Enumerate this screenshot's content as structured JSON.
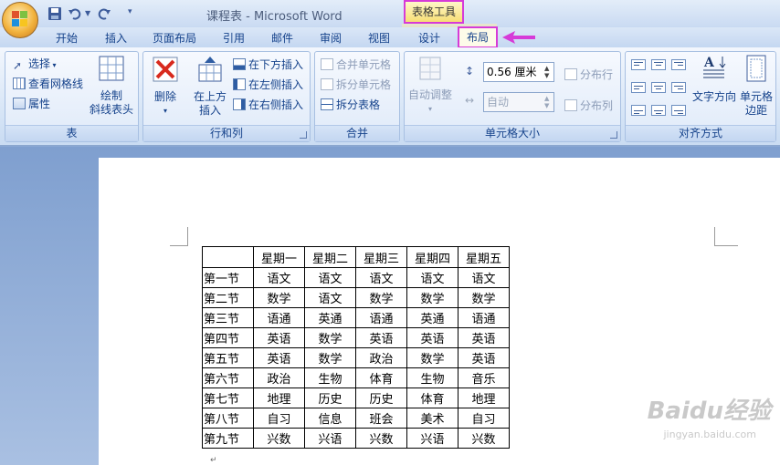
{
  "window": {
    "title": "课程表 - Microsoft Word",
    "context_tools_label": "表格工具"
  },
  "tabs": [
    "开始",
    "插入",
    "页面布局",
    "引用",
    "邮件",
    "审阅",
    "视图",
    "设计",
    "布局"
  ],
  "active_tab": "布局",
  "ribbon": {
    "table_group": {
      "label": "表",
      "select": "选择",
      "gridlines": "查看网格线",
      "properties": "属性",
      "draw_diag_1": "绘制",
      "draw_diag_2": "斜线表头"
    },
    "rows_cols_group": {
      "label": "行和列",
      "delete": "删除",
      "insert_above_1": "在上方",
      "insert_above_2": "插入",
      "insert_below": "在下方插入",
      "insert_left": "在左侧插入",
      "insert_right": "在右侧插入"
    },
    "merge_group": {
      "label": "合并",
      "merge_cells": "合并单元格",
      "split_cells": "拆分单元格",
      "split_table": "拆分表格"
    },
    "cell_size_group": {
      "label": "单元格大小",
      "autofit": "自动调整",
      "height_value": "0.56 厘米",
      "width_value": "自动",
      "distribute_rows": "分布行",
      "distribute_cols": "分布列"
    },
    "alignment_group": {
      "label": "对齐方式",
      "text_direction": "文字方向",
      "cell_margins_1": "单元格",
      "cell_margins_2": "边距"
    }
  },
  "table": {
    "header": [
      "",
      "星期一",
      "星期二",
      "星期三",
      "星期四",
      "星期五"
    ],
    "rows": [
      [
        "第一节",
        "语文",
        "语文",
        "语文",
        "语文",
        "语文"
      ],
      [
        "第二节",
        "数学",
        "语文",
        "数学",
        "数学",
        "数学"
      ],
      [
        "第三节",
        "语通",
        "英通",
        "语通",
        "英通",
        "语通"
      ],
      [
        "第四节",
        "英语",
        "数学",
        "英语",
        "英语",
        "英语"
      ],
      [
        "第五节",
        "英语",
        "数学",
        "政治",
        "数学",
        "英语"
      ],
      [
        "第六节",
        "政治",
        "生物",
        "体育",
        "生物",
        "音乐"
      ],
      [
        "第七节",
        "地理",
        "历史",
        "历史",
        "体育",
        "地理"
      ],
      [
        "第八节",
        "自习",
        "信息",
        "班会",
        "美术",
        "自习"
      ],
      [
        "第九节",
        "兴数",
        "兴语",
        "兴数",
        "兴语",
        "兴数"
      ]
    ]
  },
  "watermark": {
    "main": "Baidu经验",
    "sub": "jingyan.baidu.com"
  },
  "colors": {
    "highlight": "#d63bd8",
    "ribbon_text": "#15428b"
  }
}
